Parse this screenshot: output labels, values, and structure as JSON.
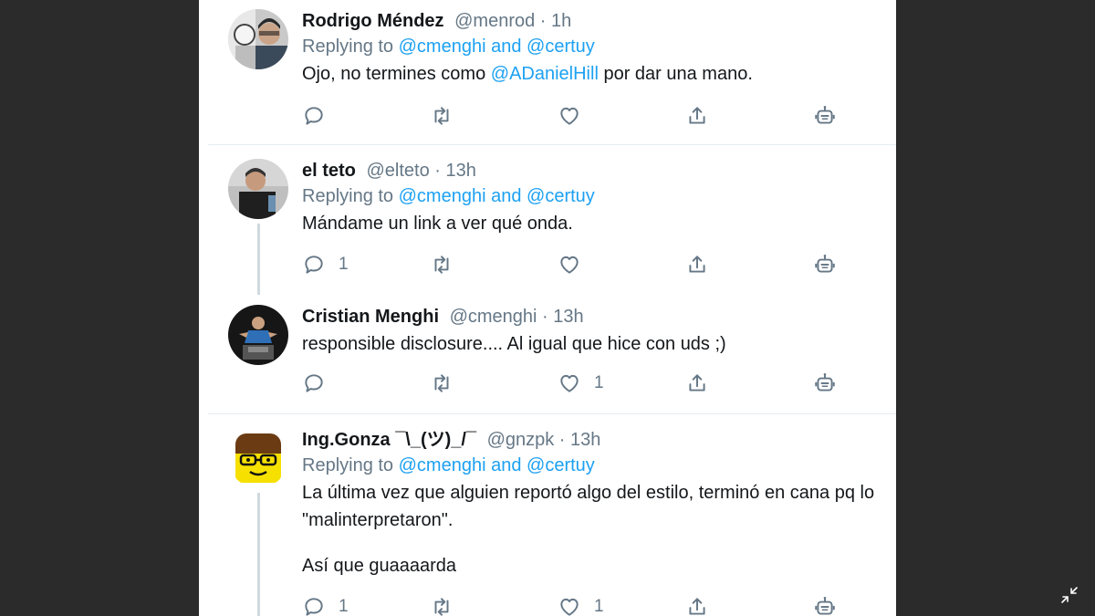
{
  "tweets": [
    {
      "name": "Rodrigo Méndez",
      "handle": "@menrod",
      "time": "· 1h",
      "replying_prefix": "Replying to",
      "replying_a": "@cmenghi",
      "replying_and": "and",
      "replying_b": "@certuy",
      "text_before": "Ojo, no termines como",
      "text_mention": "@ADanielHill",
      "text_after": "por dar una mano.",
      "reply_count": "",
      "like_count": ""
    },
    {
      "name": "el teto",
      "handle": "@elteto",
      "time": "· 13h",
      "replying_prefix": "Replying to",
      "replying_a": "@cmenghi",
      "replying_and": "and",
      "replying_b": "@certuy",
      "text": "Mándame un link a ver qué onda.",
      "reply_count": "1",
      "like_count": ""
    },
    {
      "name": "Cristian Menghi",
      "handle": "@cmenghi",
      "time": "· 13h",
      "text": "responsible disclosure.... Al igual que hice con uds ;)",
      "reply_count": "",
      "like_count": "1"
    },
    {
      "name": "Ing.Gonza ¯\\_(ツ)_/¯",
      "handle": "@gnzpk",
      "time": "· 13h",
      "replying_prefix": "Replying to",
      "replying_a": "@cmenghi",
      "replying_and": "and",
      "replying_b": "@certuy",
      "text_line1": "La última vez que alguien reportó algo del estilo, terminó en cana pq lo",
      "text_line2": "\"malinterpretaron\".",
      "text_line3": "Así que guaaaarda",
      "reply_count": "1",
      "like_count": "1"
    }
  ],
  "icons": {
    "reply": "reply-icon",
    "retweet": "retweet-icon",
    "like": "heart-icon",
    "share": "share-icon",
    "bot": "robot-icon",
    "minimize": "minimize-icon"
  },
  "colors": {
    "link": "#1da1f2",
    "text": "#14171a",
    "muted": "#657786",
    "backdrop": "#2b2b2b"
  }
}
